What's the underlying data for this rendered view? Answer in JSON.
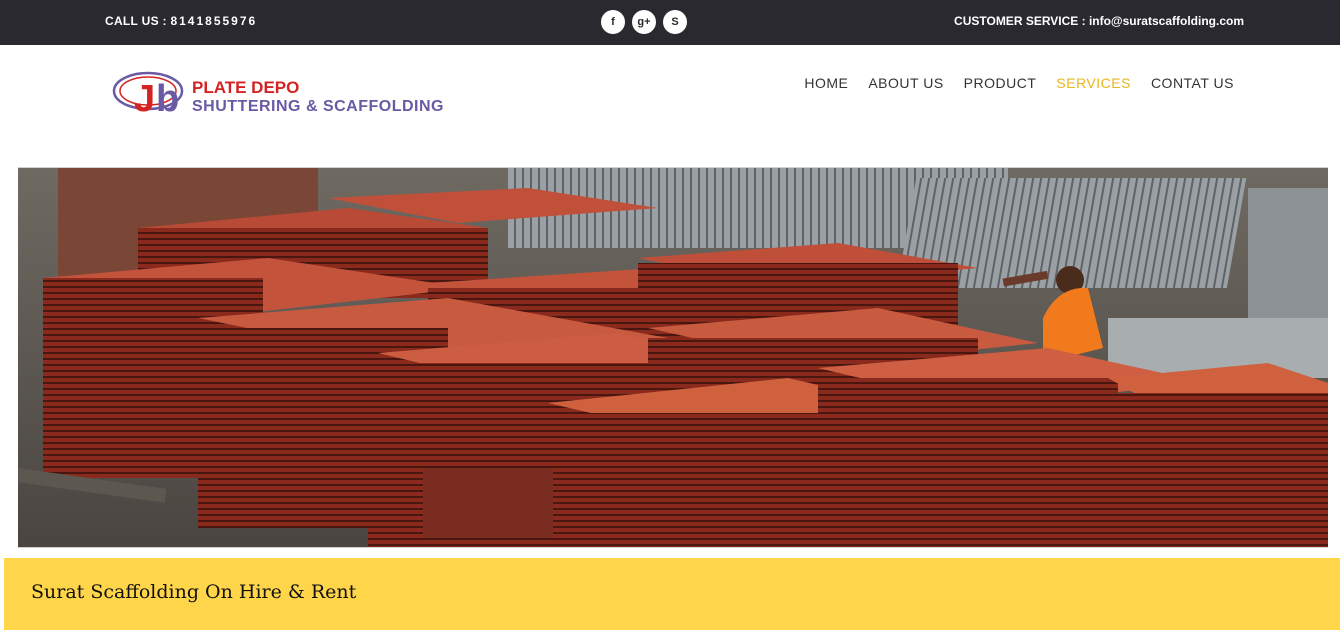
{
  "topbar": {
    "call_label": "CALL US : ",
    "call_number": "8141855976",
    "customer_service": "CUSTOMER SERVICE : info@suratscaffolding.com",
    "social": [
      {
        "icon": "facebook-icon",
        "glyph": "f"
      },
      {
        "icon": "google-plus-icon",
        "glyph": "g+"
      },
      {
        "icon": "skype-icon",
        "glyph": "S"
      }
    ]
  },
  "logo": {
    "mark": "Jb",
    "line1": "PLATE DEPO",
    "line2": "SHUTTERING & SCAFFOLDING"
  },
  "nav": {
    "items": [
      {
        "label": "HOME"
      },
      {
        "label": "ABOUT US"
      },
      {
        "label": "PRODUCT"
      },
      {
        "label": "SERVICES",
        "active": true
      },
      {
        "label": "CONTAT US"
      }
    ]
  },
  "banner": {
    "title": "Surat Scaffolding On Hire & Rent"
  },
  "colors": {
    "topbar": "#2a2930",
    "accent": "#e8b621",
    "banner": "#ffd54a",
    "logo_red": "#d42323",
    "logo_purple": "#6a5aa6"
  }
}
